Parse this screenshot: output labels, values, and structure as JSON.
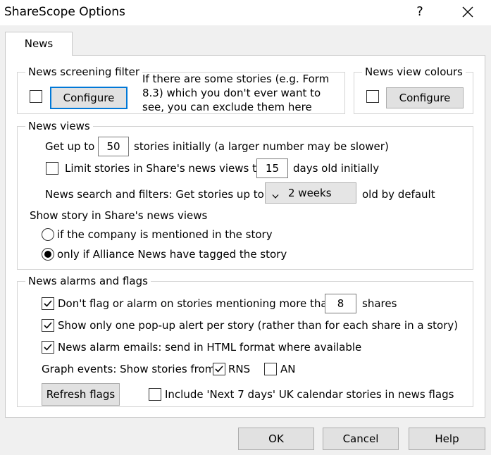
{
  "window": {
    "title": "ShareScope Options",
    "help_glyph": "?"
  },
  "tab": {
    "label": "News"
  },
  "screening": {
    "legend": "News screening filter",
    "configure_label": "Configure",
    "description_line1": "If there are some stories (e.g. Form",
    "description_line2": "8.3) which you don't ever want to",
    "description_line3": "see, you can exclude them here",
    "checked": false
  },
  "colours": {
    "legend": "News view colours",
    "configure_label": "Configure",
    "checked": false
  },
  "views": {
    "legend": "News views",
    "get_up_to_label": "Get up to",
    "stories_count": "50",
    "stories_suffix": "stories initially (a larger number may be slower)",
    "limit_label": "Limit stories in Share's news views to",
    "limit_checked": false,
    "days_value": "15",
    "days_suffix": "days old initially",
    "search_label": "News search and filters:  Get stories up to",
    "period_value": "2 weeks",
    "period_suffix": "old by default",
    "show_story_label": "Show story in Share's news views",
    "radio_mentioned": "if the company is mentioned in the story",
    "radio_tagged": "only if Alliance News have tagged the story",
    "selected_option": "tagged"
  },
  "alarms": {
    "legend": "News alarms and flags",
    "dont_flag_label": "Don't flag or alarm on stories mentioning more than",
    "shares_value": "8",
    "shares_suffix": "shares",
    "one_popup_label": "Show only one pop-up alert per story (rather than for each share in a story)",
    "html_email_label": "News alarm emails: send in HTML format where available",
    "graph_events_label": "Graph events: Show stories from",
    "rns_label": "RNS",
    "an_label": "AN",
    "refresh_label": "Refresh flags",
    "next7_label": "Include 'Next 7 days' UK calendar stories in news flags",
    "checks": {
      "dont_flag": true,
      "one_popup": true,
      "html_email": true,
      "rns": true,
      "an": false,
      "next7": false
    }
  },
  "footer": {
    "ok_label": "OK",
    "cancel_label": "Cancel",
    "help_label": "Help"
  }
}
